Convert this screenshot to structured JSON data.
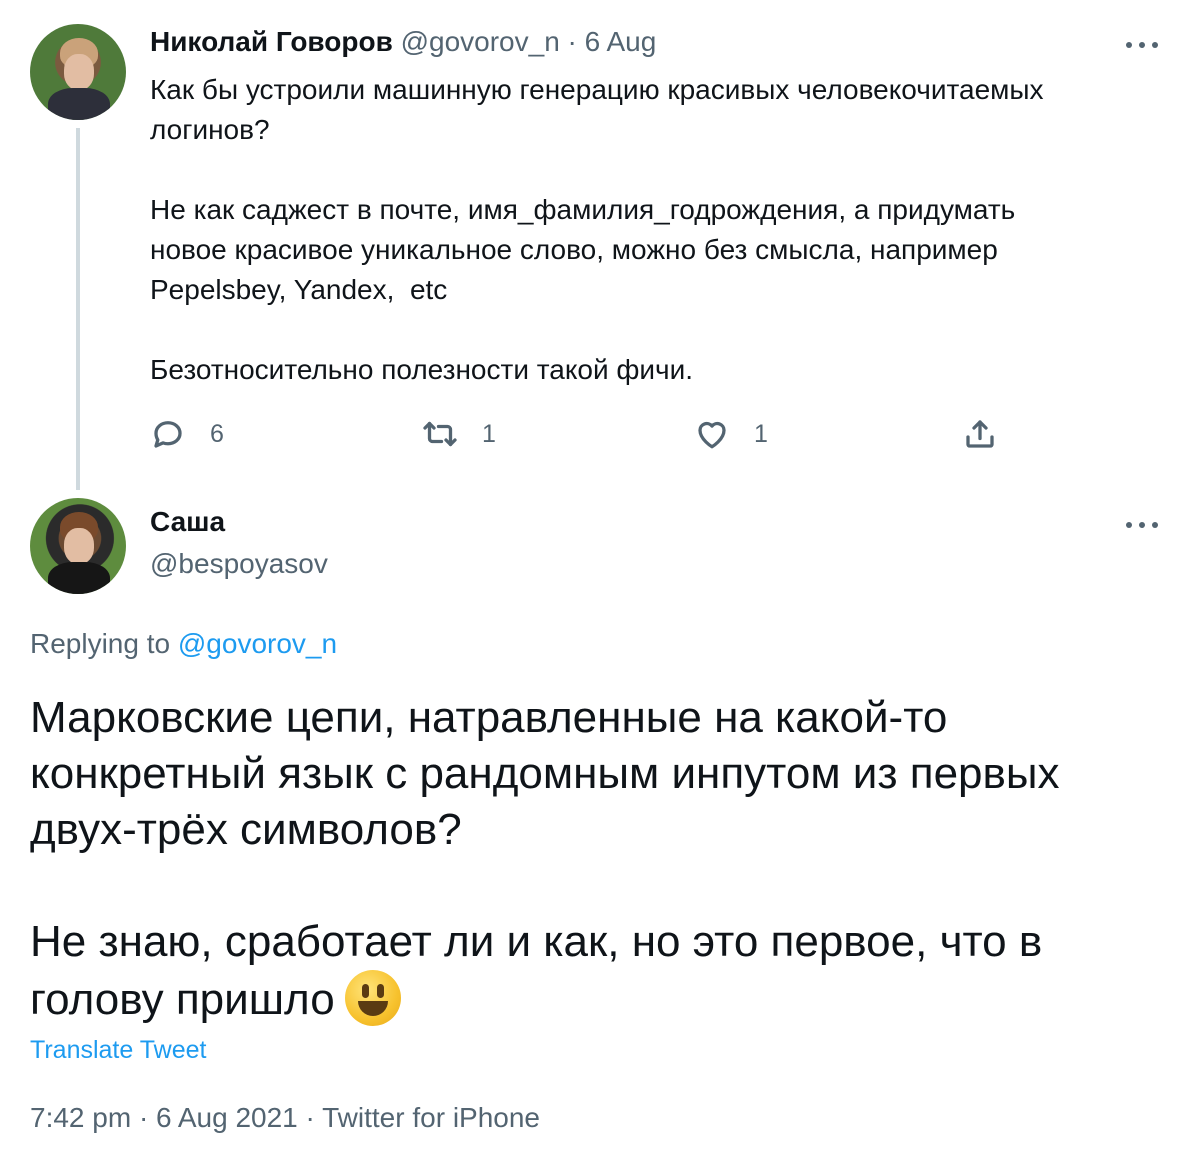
{
  "parent_tweet": {
    "author_name": "Николай Говоров",
    "handle": "@govorov_n",
    "separator": " · ",
    "date": "6 Aug",
    "text": "Как бы устроили машинную генерацию красивых человекочитаемых\nлогинов?\n\nНе как саджест в почте, имя_фамилия_годрождения, а придумать\nновое красивое уникальное слово, можно без смысла, например\nPepelsbey, Yandex,  etc\n\nБезотносительно полезности такой фичи.",
    "actions": {
      "reply_count": "6",
      "retweet_count": "1",
      "like_count": "1"
    },
    "icons": [
      "reply-icon",
      "retweet-icon",
      "like-icon",
      "share-icon",
      "more-icon"
    ]
  },
  "reply_tweet": {
    "author_name": "Саша",
    "handle": "@bespoyasov",
    "replying_prefix": "Replying to ",
    "replying_handle": "@govorov_n",
    "text": "Марковские цепи, натравленные на какой-то\nконкретный язык с рандомным инпутом из первых\nдвух-трёх символов?\n\nНе знаю, сработает ли и как, но это первое, что в\nголову пришло",
    "emoji": "smiling-face-icon",
    "translate_label": "Translate Tweet",
    "meta": "7:42 pm · 6 Aug 2021 · Twitter for iPhone"
  },
  "colors": {
    "text": "#0f1419",
    "muted": "#536471",
    "link": "#1d9bf0",
    "thread_line": "#cfd9de"
  }
}
